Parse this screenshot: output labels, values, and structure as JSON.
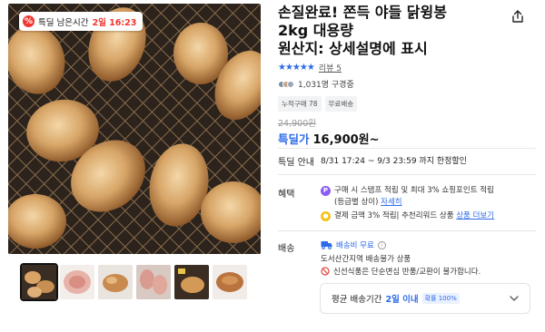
{
  "product": {
    "title_line1": "손질완료! 쫀득 야들 닭윙봉",
    "title_line2": "2kg 대용량",
    "title_line3": "원산지: 상세설명에 표시",
    "deal_badge": {
      "label": "특딜 남은시간",
      "time": "2일 16:23",
      "icon": "percent-icon"
    }
  },
  "share": {
    "icon": "share-icon"
  },
  "rating": {
    "stars": "★★★★★",
    "review_label": "리뷰 5"
  },
  "buyers": {
    "count_text": "1,031명 구경중",
    "dot_colors": [
      "#7a8ea6",
      "#c3a48a",
      "#9aa7b5"
    ]
  },
  "chips": [
    "누적구매 78",
    "무료배송"
  ],
  "price": {
    "original": "24,900원",
    "label": "특딜가",
    "final": "16,900원~"
  },
  "deal_info": {
    "label": "특딜 안내",
    "period": "8/31 17:24 ~ 9/3 23:59 까지 한정할인"
  },
  "benefits": {
    "label": "혜택",
    "line1": "구매 시 스탬프 적립 및 최대 3% 쇼핑포인트 적립",
    "line2_prefix": "(등급별 상이)",
    "line2_link": "자세히",
    "line3_prefix": "결제 금액 3% 적립| 추천리워드 상품",
    "line3_link": "상품 더보기"
  },
  "shipping": {
    "label": "배송",
    "free_label": "배송비 무료",
    "free_info_icon": "info-icon",
    "restriction": "도서산간지역 배송불가 상품",
    "no_return": "신선식품은 단순변심 반품/교환이 불가합니다.",
    "avg_label": "평균 배송기간",
    "avg_days": "2일 이내",
    "avg_rate": "확률 100%"
  },
  "colors": {
    "accent": "#2f6be8",
    "deal_red": "#f0362e"
  }
}
